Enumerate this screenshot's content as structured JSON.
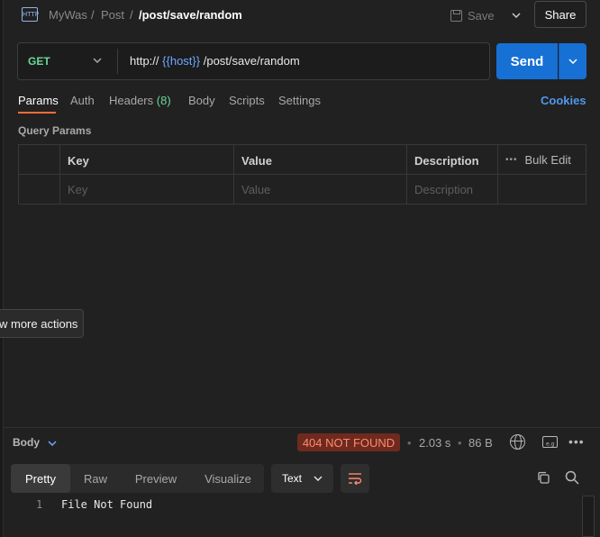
{
  "header": {
    "protocol_icon": "http-icon",
    "breadcrumb": [
      "MyWas",
      "/",
      "Post",
      "/"
    ],
    "current": "/post/save/random",
    "save_label": "Save",
    "share_label": "Share"
  },
  "request": {
    "method": "GET",
    "url_prefix": "http://",
    "url_variable": "{{host}}",
    "url_suffix": "/post/save/random",
    "send_label": "Send"
  },
  "tabs": [
    {
      "label": "Params",
      "active": true
    },
    {
      "label": "Auth"
    },
    {
      "label": "Headers",
      "count": "(8)"
    },
    {
      "label": "Body"
    },
    {
      "label": "Scripts"
    },
    {
      "label": "Settings"
    }
  ],
  "cookies_label": "Cookies",
  "query_params": {
    "title": "Query Params",
    "columns": [
      "Key",
      "Value",
      "Description"
    ],
    "bulk_edit": "Bulk Edit",
    "placeholders": [
      "Key",
      "Value",
      "Description"
    ]
  },
  "tooltip": "w more actions",
  "response": {
    "section_label": "Body",
    "status": "404 NOT FOUND",
    "time": "2.03 s",
    "size": "86 B",
    "view_tabs": [
      "Pretty",
      "Raw",
      "Preview",
      "Visualize"
    ],
    "active_view": "Pretty",
    "format": "Text",
    "lines": [
      {
        "number": "1",
        "text": "File Not Found"
      }
    ]
  },
  "colors": {
    "method_get": "#6bd89a",
    "send": "#1770d4",
    "accent_tab": "#ff6c37",
    "variable": "#6ea8ff",
    "status_error_bg": "#6e2a1e",
    "status_error_text": "#ff8b6e",
    "link": "#4f98ec"
  }
}
